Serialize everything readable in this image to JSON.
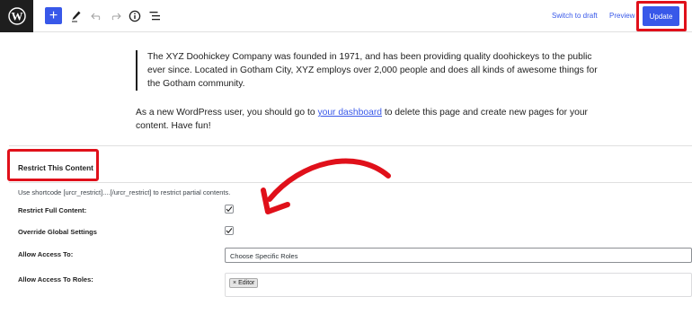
{
  "toolbar": {
    "add_label": "+",
    "switch_to_draft": "Switch to draft",
    "preview": "Preview",
    "update": "Update"
  },
  "content": {
    "quote": "The XYZ Doohickey Company was founded in 1971, and has been providing quality doohickeys to the public ever since. Located in Gotham City, XYZ employs over 2,000 people and does all kinds of awesome things for the Gotham community.",
    "para_before_link": "As a new WordPress user, you should go to ",
    "para_link": "your dashboard",
    "para_after_link": " to delete this page and create new pages for your content. Have fun!"
  },
  "metabox": {
    "title": "Restrict This Content",
    "shortcode_hint": "Use shortcode [urcr_restrict]....[/urcr_restrict] to restrict partial contents.",
    "restrict_full_label": "Restrict Full Content:",
    "restrict_full_checked": true,
    "override_global_label": "Override Global Settings",
    "override_global_checked": true,
    "allow_access_label": "Allow Access To:",
    "allow_access_value": "Choose Specific Roles",
    "allow_roles_label": "Allow Access To Roles:",
    "roles": [
      {
        "remove": "×",
        "label": "Editor"
      }
    ]
  },
  "annotations": {
    "highlight_color": "#e0101a",
    "arrow_color": "#e0101a"
  },
  "colors": {
    "accent": "#3858e9",
    "logo_bg": "#1e1e1e"
  },
  "icons": [
    "wordpress-logo-icon",
    "pencil-icon",
    "undo-icon",
    "redo-icon",
    "info-icon",
    "list-view-icon",
    "checkmark-icon"
  ]
}
